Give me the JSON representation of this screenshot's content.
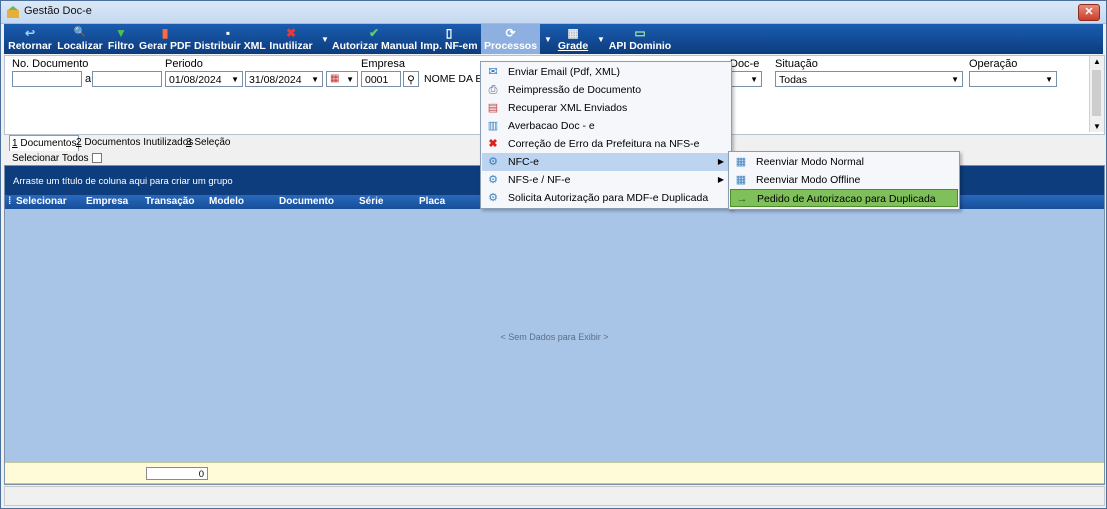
{
  "window": {
    "title": "Gestão Doc-e",
    "close_label": "✕"
  },
  "toolbar": {
    "buttons": [
      {
        "label": "Retornar",
        "icon": "↩"
      },
      {
        "label": "Localizar",
        "icon": "🔍"
      },
      {
        "label": "Filtro",
        "icon": "▼"
      },
      {
        "label": "Gerar PDF",
        "icon": "▮"
      },
      {
        "label": "Distribuir XML",
        "icon": "▪"
      },
      {
        "label": "Inutilizar",
        "icon": "✖"
      },
      {
        "label": "Autorizar Manual",
        "icon": "✔"
      },
      {
        "label": "Imp. NF-em",
        "icon": "▯"
      },
      {
        "label": "Processos",
        "icon": "⟳"
      },
      {
        "label": "Grade",
        "icon": "▦"
      },
      {
        "label": "API Dominio",
        "icon": "▭"
      }
    ],
    "colors": {
      "bar": "#0c3c7e",
      "active": "#8db0e0"
    }
  },
  "filters": {
    "numero_label": "No. Documento",
    "numero_from": "",
    "a_label": "a",
    "numero_to": "",
    "periodo_label": "Periodo",
    "periodo_from": "01/08/2024",
    "periodo_to": "31/08/2024",
    "empresa_label": "Empresa",
    "empresa_code": "0001",
    "empresa_name": "NOME DA EM",
    "doce_label": "Doc-e",
    "situacao_label": "Situação",
    "situacao_value": "Todas",
    "operacao_label": "Operação",
    "operacao_value": ""
  },
  "tabs": [
    {
      "num": "1",
      "label": " Documentos"
    },
    {
      "num": "2",
      "label": " Documentos Inutilizados"
    },
    {
      "num": "3",
      "label": " Seleção"
    }
  ],
  "select_all_label": "Selecionar Todos",
  "grid": {
    "group_hint": "Arraste um título de coluna aqui para criar um grupo",
    "columns": [
      "Selecionar",
      "Empresa",
      "Transação",
      "Modelo",
      "Documento",
      "Série",
      "Placa"
    ],
    "empty_text": "< Sem Dados para Exibir >",
    "footer_total": "0"
  },
  "processos_menu": [
    {
      "label": "Enviar Email (Pdf, XML)",
      "icon": "✉"
    },
    {
      "label": "Reimpressão de Documento",
      "icon": "⎙"
    },
    {
      "label": "Recuperar XML Enviados",
      "icon": "▤"
    },
    {
      "label": "Averbacao Doc - e",
      "icon": "▥"
    },
    {
      "label": "Correção de Erro da Prefeitura na NFS-e",
      "icon": "✖"
    },
    {
      "label": "NFC-e",
      "icon": "⚙",
      "submenu": true
    },
    {
      "label": "NFS-e / NF-e",
      "icon": "⚙",
      "submenu": true
    },
    {
      "label": "Solicita Autorização para MDF-e Duplicada",
      "icon": "⚙"
    }
  ],
  "nfce_submenu": [
    {
      "label": "Reenviar Modo Normal",
      "icon": "▦"
    },
    {
      "label": "Reenviar Modo Offline",
      "icon": "▦"
    },
    {
      "label": "Pedido de Autorizacao para Duplicada",
      "icon": "→"
    }
  ]
}
